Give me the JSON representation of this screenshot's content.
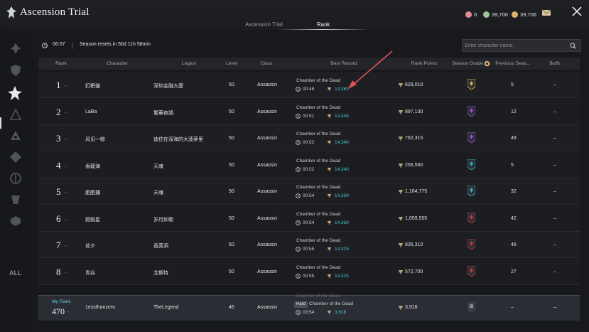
{
  "app": {
    "title": "Ascension Trial"
  },
  "currencies": [
    {
      "value": "0",
      "color": "#e38a97",
      "icon": "crystal-icon"
    },
    {
      "value": "39,706",
      "color": "#9fc39a",
      "icon": "coin-green-icon"
    },
    {
      "value": "39,706",
      "color": "#d9b46a",
      "icon": "coin-gold-icon"
    }
  ],
  "tabs": [
    {
      "label": "Ascension Trial",
      "active": false
    },
    {
      "label": "Rank",
      "active": true
    }
  ],
  "sidebar": {
    "all_label": "ALL"
  },
  "info": {
    "time": "06:07",
    "reset_text": "Season resets in 50d 11h 58min",
    "search_placeholder": "Enter character name."
  },
  "columns": {
    "rank": "Rank",
    "character": "Character",
    "legion": "Legion",
    "level": "Level",
    "class": "Class",
    "best_record": "Best Record",
    "rank_points": "Rank Points",
    "season_grade": "Season Grade",
    "previous_season": "Previous Seas...",
    "buffs": "Buffs"
  },
  "rows": [
    {
      "rank": "1",
      "change": "-",
      "character": "釘粑貓",
      "legion": "深圳金融大廈",
      "level": "50",
      "class": "Assassin",
      "dungeon": "Chamber of the Dead",
      "time": "00:48",
      "score": "14,360",
      "points": "628,010",
      "previous": "5",
      "buffs": "–",
      "badge": "#d9a24a"
    },
    {
      "rank": "2",
      "change": "-",
      "character": "LaBa",
      "legion": "繁華夜語",
      "level": "50",
      "class": "Assassin",
      "dungeon": "Chamber of the Dead",
      "time": "00:51",
      "score": "14,345",
      "points": "897,130",
      "previous": "12",
      "buffs": "–",
      "badge": "#9b4bd1"
    },
    {
      "rank": "3",
      "change": "-",
      "character": "风见一鲸",
      "legion": "迪住在深海的大菠萝里",
      "level": "50",
      "class": "Assassin",
      "dungeon": "Chamber of the Dead",
      "time": "00:52",
      "score": "14,340",
      "points": "762,315",
      "previous": "49",
      "buffs": "–",
      "badge": "#9b4bd1"
    },
    {
      "rank": "4",
      "change": "-",
      "character": "香龍海",
      "legion": "天魂",
      "level": "50",
      "class": "Assassin",
      "dungeon": "Chamber of the Dead",
      "time": "00:52",
      "score": "14,340",
      "points": "256,560",
      "previous": "5",
      "buffs": "–",
      "badge": "#3aa6b8"
    },
    {
      "rank": "5",
      "change": "-",
      "character": "肥肥捕",
      "legion": "天魂",
      "level": "50",
      "class": "Assassin",
      "dungeon": "Chamber of the Dead",
      "time": "00:54",
      "score": "14,330",
      "points": "1,164,775",
      "previous": "32",
      "buffs": "–",
      "badge": "#3aa6b8"
    },
    {
      "rank": "6",
      "change": "-",
      "character": "超殺星",
      "legion": "岁月如歌",
      "level": "50",
      "class": "Assassin",
      "dungeon": "Chamber of the Dead",
      "time": "00:54",
      "score": "14,330",
      "points": "1,059,555",
      "previous": "42",
      "buffs": "–",
      "badge": "#c2393a"
    },
    {
      "rank": "7",
      "change": "-",
      "character": "花夕",
      "legion": "香萁洞",
      "level": "50",
      "class": "Assassin",
      "dungeon": "Chamber of the Dead",
      "time": "00:55",
      "score": "14,325",
      "points": "835,310",
      "previous": "46",
      "buffs": "–",
      "badge": "#c2393a"
    },
    {
      "rank": "8",
      "change": "-",
      "character": "青谷",
      "legion": "艾斯特",
      "level": "50",
      "class": "Assassin",
      "dungeon": "Chamber of the Dead",
      "time": "00:55",
      "score": "14,325",
      "points": "572,700",
      "previous": "27",
      "buffs": "–",
      "badge": "#c2393a"
    }
  ],
  "my_rank": {
    "label": "My Rank",
    "rank": "470",
    "change": "-",
    "character": "1essthanzero",
    "legion": "TheLegend",
    "level": "46",
    "class": "Assassin",
    "difficulty": "Hard",
    "dungeon": "Chamber of the Dead",
    "time": "03:54",
    "score": "3,918",
    "points": "3,918",
    "previous": "–",
    "buffs": "–",
    "overlap_text": "Chamber of the Dead"
  },
  "colors": {
    "accent": "#44c6d8",
    "arrow": "#e0505a"
  }
}
